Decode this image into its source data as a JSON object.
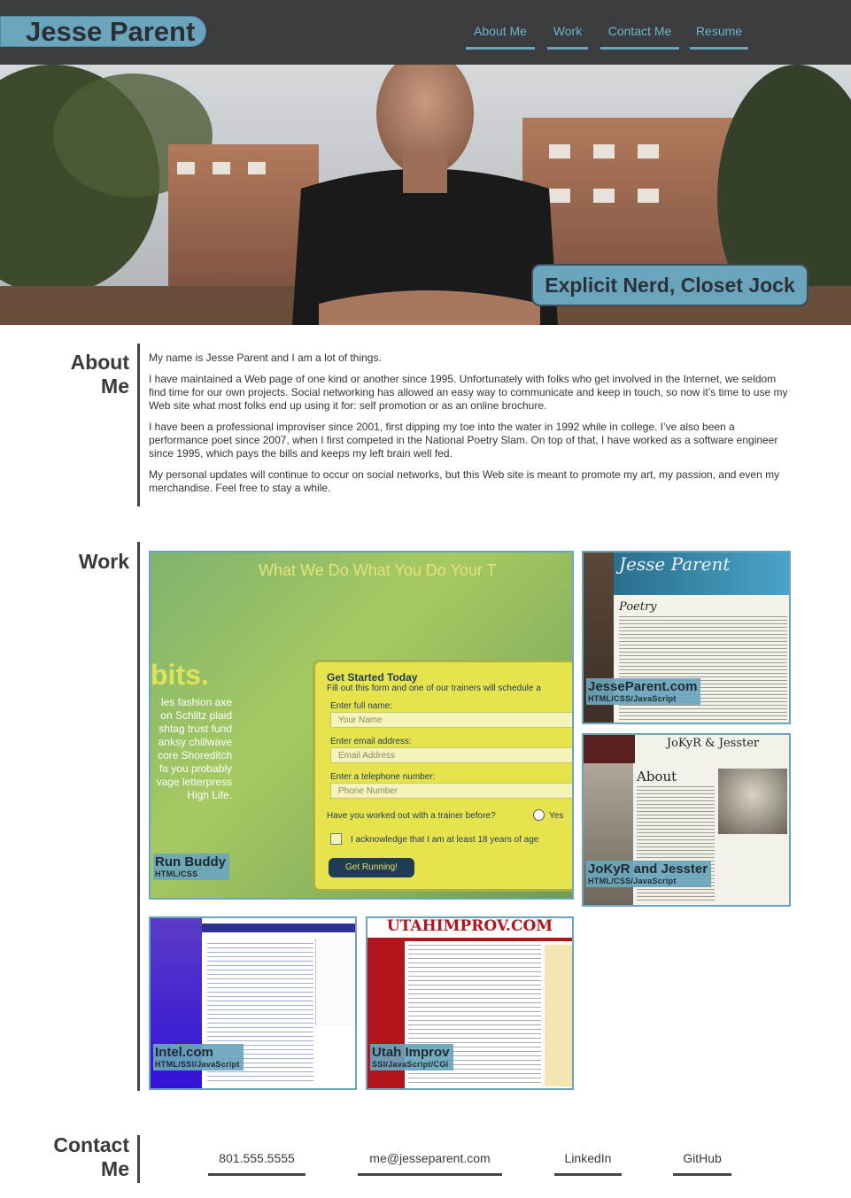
{
  "header": {
    "logo": "Jesse Parent",
    "nav": [
      "About Me",
      "Work",
      "Contact Me",
      "Resume"
    ]
  },
  "hero": {
    "tagline": "Explicit Nerd, Closet Jock"
  },
  "about": {
    "title_line1": "About",
    "title_line2": "Me",
    "paragraphs": [
      "My name is Jesse Parent and I am a lot of things.",
      "I have maintained a Web page of one kind or another since 1995. Unfortunately with folks who get involved in the Internet, we seldom find time for our own projects. Social networking has allowed an easy way to communicate and keep in touch, so now it’s time to use my Web site what most folks end up using it for: self promotion or as an online brochure.",
      "I have been a professional improviser since 2001, first dipping my toe into the water in 1992 while in college. I’ve also been a performance poet since 2007, when I first competed in the National Poetry Slam. On top of that, I have worked as a software engineer since 1995, which pays the bills and keeps my left brain well fed.",
      "My personal updates will continue to occur on social networks, but this Web site is meant to promote my art, my passion, and even my merchandise. Feel free to stay a while."
    ]
  },
  "work": {
    "title": "Work",
    "projects": [
      {
        "name": "Run Buddy",
        "tech": "HTML/CSS"
      },
      {
        "name": "JesseParent.com",
        "tech": "HTML/CSS/JavaScript"
      },
      {
        "name": "JoKyR and Jesster",
        "tech": "HTML/CSS/JavaScript"
      },
      {
        "name": "Intel.com",
        "tech": "HTML/SSI/JavaScript"
      },
      {
        "name": "Utah Improv",
        "tech": "SSI/JavaScript/CGI"
      }
    ],
    "runbuddy_preview": {
      "nav": "What We Do   What You Do   Your T",
      "slogan": "bits.",
      "filler": [
        "les fashion axe",
        "on Schlitz plaid",
        "shtag trust fund",
        "anksy chillwave",
        "core Shoreditch",
        "fa you probably",
        "vage letterpress",
        "High Life."
      ],
      "form_title": "Get Started Today",
      "form_sub": "Fill out this form and one of our trainers will schedule a",
      "name_label": "Enter full name:",
      "name_placeholder": "Your Name",
      "email_label": "Enter email address:",
      "email_placeholder": "Email Address",
      "phone_label": "Enter a telephone number:",
      "phone_placeholder": "Phone Number",
      "trainer_q": "Have you worked out with a trainer before?",
      "yes": "Yes",
      "ack": "I acknowledge that I am at least 18 years of age",
      "cta": "Get Running!"
    },
    "jp_preview": {
      "banner": "Jesse Parent",
      "heading": "Poetry"
    },
    "jj_preview": {
      "banner": "JoKyR & Jesster",
      "heading": "About"
    },
    "utah_preview": {
      "banner": "UTAHIMPROV.COM"
    }
  },
  "contact": {
    "title_line1": "Contact",
    "title_line2": "Me",
    "links": [
      "801.555.5555",
      "me@jesseparent.com",
      "LinkedIn",
      "GitHub"
    ]
  },
  "colors": {
    "header_bg": "#3b3c3d",
    "accent": "#6aa5bd",
    "nav_text": "#6db6d3"
  }
}
